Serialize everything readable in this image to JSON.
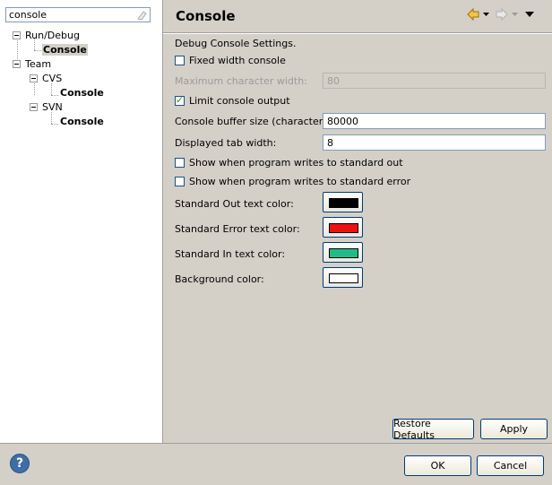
{
  "filter": {
    "value": "console"
  },
  "tree": [
    {
      "label": "Run/Debug",
      "bold": false
    },
    {
      "label": "Console",
      "bold": true
    },
    {
      "label": "Team",
      "bold": false
    },
    {
      "label": "CVS",
      "bold": false
    },
    {
      "label": "Console",
      "bold": true
    },
    {
      "label": "SVN",
      "bold": false
    },
    {
      "label": "Console",
      "bold": true
    }
  ],
  "page": {
    "title": "Console",
    "description": "Debug Console Settings.",
    "fixed_width": {
      "label": "Fixed width console",
      "checked": false
    },
    "max_char_width": {
      "label": "Maximum character width:",
      "value": "80",
      "enabled": false
    },
    "limit_output": {
      "label": "Limit console output",
      "checked": true
    },
    "buffer_size": {
      "label": "Console buffer size (characters):",
      "value": "80000"
    },
    "tab_width": {
      "label": "Displayed tab width:",
      "value": "8"
    },
    "show_stdout": {
      "label": "Show when program writes to standard out",
      "checked": false
    },
    "show_stderr": {
      "label": "Show when program writes to standard error",
      "checked": false
    },
    "colors": [
      {
        "label": "Standard Out text color:",
        "color": "#000000"
      },
      {
        "label": "Standard Error text color:",
        "color": "#ee1111"
      },
      {
        "label": "Standard In text color:",
        "color": "#22bb88"
      },
      {
        "label": "Background color:",
        "color": "#ffffff"
      }
    ],
    "restore_defaults": "Restore Defaults",
    "apply": "Apply"
  },
  "footer": {
    "ok": "OK",
    "cancel": "Cancel",
    "help": "?"
  }
}
